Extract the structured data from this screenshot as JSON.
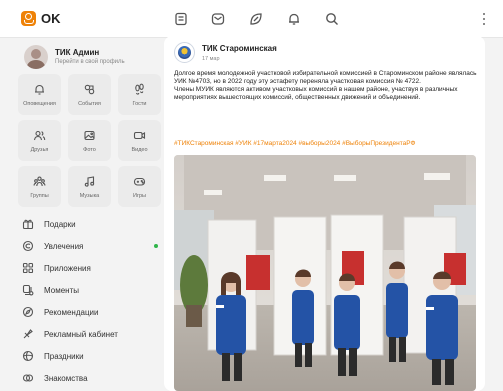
{
  "header": {
    "logo_text": "OK",
    "icons": [
      "feed-icon",
      "messages-icon",
      "discussions-icon",
      "notifications-icon",
      "search-icon",
      "more-icon"
    ]
  },
  "sidebar": {
    "profile": {
      "name": "ТИК Админ",
      "sub": "Перейти в свой профиль"
    },
    "tiles": [
      {
        "label": "Оповещения",
        "icon": "bell-icon"
      },
      {
        "label": "События",
        "icon": "events-icon"
      },
      {
        "label": "Гости",
        "icon": "footprints-icon"
      },
      {
        "label": "Друзья",
        "icon": "friends-icon"
      },
      {
        "label": "Фото",
        "icon": "photo-icon"
      },
      {
        "label": "Видео",
        "icon": "video-icon"
      },
      {
        "label": "Группы",
        "icon": "groups-icon"
      },
      {
        "label": "Музыка",
        "icon": "music-icon"
      },
      {
        "label": "Игры",
        "icon": "gamepad-icon"
      }
    ],
    "menu": [
      {
        "label": "Подарки",
        "icon": "gift-icon"
      },
      {
        "label": "Увлечения",
        "icon": "hobbies-icon"
      },
      {
        "label": "Приложения",
        "icon": "apps-icon"
      },
      {
        "label": "Моменты",
        "icon": "moments-icon"
      },
      {
        "label": "Рекомендации",
        "icon": "recommendations-icon"
      },
      {
        "label": "Рекламный кабинет",
        "icon": "ads-icon"
      },
      {
        "label": "Праздники",
        "icon": "holidays-icon"
      },
      {
        "label": "Знакомства",
        "icon": "dating-icon"
      }
    ]
  },
  "post": {
    "group_name": "ТИК Староминская",
    "date": "17 мар",
    "text_p1": "Долгое время молодежной участковой избирательной комиссией в Староминском районе являлась УИК №4703, но в 2022 году эту эстафету переняла участковая комиссия № 4722.",
    "text_p2": "Члены МУИК являются активом участковых комиссий в нашем районе, участвуя в различных мероприятиях вышестоящих комиссий, общественных движений и объединений.",
    "hashtags": "#ТИКСтароминская #УИК #17марта2024 #выборы2024 #ВыборыПрезидентаРФ"
  },
  "colors": {
    "accent": "#ee8208",
    "online": "#2fb54a"
  }
}
